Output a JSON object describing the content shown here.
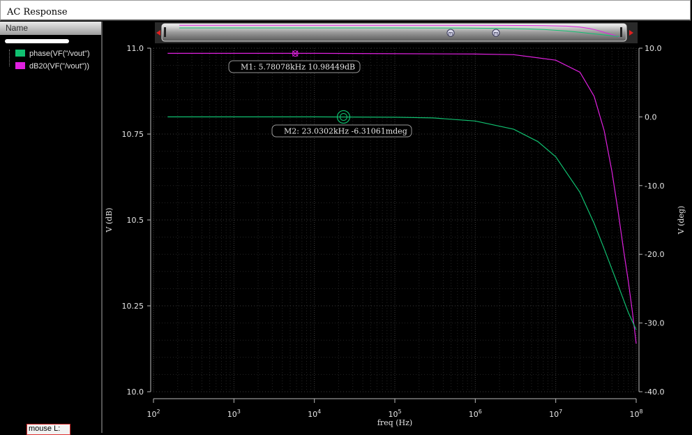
{
  "window": {
    "title": "AC Response"
  },
  "sidebar": {
    "header": "Name",
    "legend": [
      {
        "label": "phase(VF(\"/vout\")",
        "color": "#10c070"
      },
      {
        "label": "dB20(VF(\"/vout\"))",
        "color": "#e020e0"
      }
    ],
    "status": "mouse L:"
  },
  "chart_data": {
    "type": "line",
    "xlabel": "freq (Hz)",
    "xscale": "log",
    "xlim": [
      100,
      100000000
    ],
    "x_ticks": [
      "10^2",
      "10^3",
      "10^4",
      "10^5",
      "10^6",
      "10^7",
      "10^8"
    ],
    "y_left": {
      "label": "V (dB)",
      "lim": [
        10.0,
        11.0
      ],
      "ticks": [
        "11.0",
        "10.75",
        "10.5",
        "10.25",
        "10.0"
      ]
    },
    "y_right": {
      "label": "V (deg)",
      "lim": [
        -40.0,
        10.0
      ],
      "ticks": [
        "10.0",
        "0.0",
        "-10.0",
        "-20.0",
        "-30.0",
        "-40.0"
      ]
    },
    "grid": true,
    "series": [
      {
        "name": "dB20(VF(\"/vout\"))",
        "axis": "left",
        "color": "#e020e0",
        "x": [
          150,
          1000,
          10000,
          100000,
          1000000,
          3000000,
          10000000,
          20000000,
          30000000,
          40000000,
          50000000,
          60000000,
          70000000,
          80000000,
          90000000,
          100000000
        ],
        "y": [
          10.985,
          10.985,
          10.985,
          10.984,
          10.983,
          10.981,
          10.965,
          10.93,
          10.86,
          10.76,
          10.64,
          10.52,
          10.41,
          10.32,
          10.23,
          10.14
        ]
      },
      {
        "name": "phase(VF(\"/vout\")",
        "axis": "right",
        "color": "#10c070",
        "x": [
          150,
          1000,
          10000,
          100000,
          300000,
          1000000,
          3000000,
          6000000,
          10000000,
          20000000,
          30000000,
          40000000,
          60000000,
          80000000,
          100000000
        ],
        "y": [
          0.0,
          0.0,
          0.0,
          -0.05,
          -0.15,
          -0.6,
          -1.8,
          -3.6,
          -5.8,
          -11.0,
          -15.5,
          -19.2,
          -24.6,
          -28.5,
          -31.0
        ]
      }
    ],
    "markers": [
      {
        "name": "M1",
        "label": "M1: 5.78078kHz 10.98449dB",
        "x": 5780.78,
        "y": 10.98449,
        "axis": "left",
        "color": "#e020e0"
      },
      {
        "name": "M2",
        "label": "M2: 23.0302kHz -6.31061mdeg",
        "x": 23030.2,
        "y": -0.00631061,
        "axis": "right",
        "color": "#10c070"
      }
    ],
    "overview": {
      "marker_glyph": "m"
    }
  }
}
